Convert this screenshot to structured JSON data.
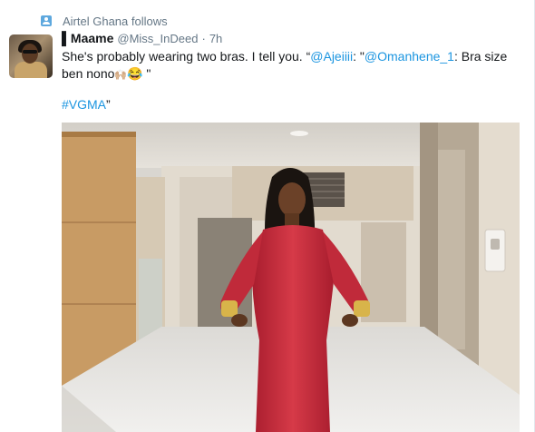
{
  "social_context": {
    "icon": "person-icon",
    "text": "Airtel Ghana follows"
  },
  "tweet": {
    "name": "▌Maame",
    "handle": "@Miss_InDeed",
    "separator": "·",
    "time": "7h",
    "text_1": "She's probably wearing two bras. I tell you. “",
    "mention_1": "@Ajeiiii",
    "text_2": ": \"",
    "mention_2": "@Omanhene_1",
    "text_3": ": Bra size ben nono",
    "emoji_1": "🙌🏼",
    "emoji_2": "😂",
    "text_4": " \"",
    "hashtag": "#VGMA",
    "hashtag_suffix": "”"
  },
  "media": {
    "description_icon": "photo",
    "colors": {
      "dress": "#c8283a",
      "floor": "#ecebe8",
      "wall": "#e3ddd2",
      "marble": "#b9ad9c",
      "wood": "#c79a63"
    }
  },
  "colors": {
    "link": "#1b95e0",
    "secondary_text": "#657786",
    "primary_text": "#14171a",
    "follow_icon": "#5ea8de"
  }
}
